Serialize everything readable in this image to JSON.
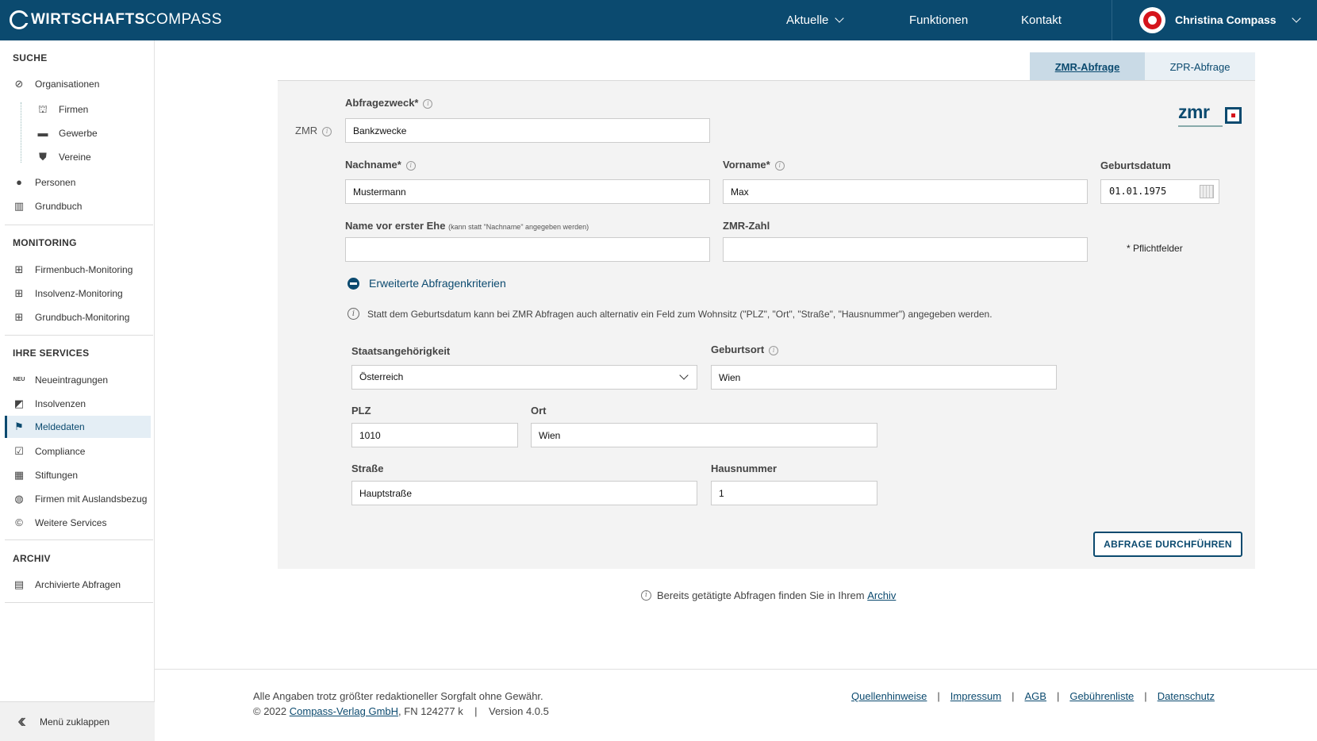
{
  "header": {
    "logo_bold": "WIRTSCHAFTS",
    "logo_light": "COMPASS",
    "nav": [
      "Aktuelle",
      "Funktionen",
      "Kontakt"
    ],
    "user_name": "Christina Compass"
  },
  "sidebar": {
    "suche_title": "SUCHE",
    "suche_items": [
      "Organisationen",
      "Firmen",
      "Gewerbe",
      "Vereine",
      "Personen",
      "Grundbuch"
    ],
    "monitoring_title": "MONITORING",
    "monitoring_items": [
      "Firmenbuch-Monitoring",
      "Insolvenz-Monitoring",
      "Grundbuch-Monitoring"
    ],
    "services_title": "IHRE SERVICES",
    "services_items": [
      "Neueintragungen",
      "Insolvenzen",
      "Meldedaten",
      "Compliance",
      "Stiftungen",
      "Firmen mit Auslandsbezug",
      "Weitere Services"
    ],
    "neu_badge": "NEU",
    "archiv_title": "ARCHIV",
    "archiv_items": [
      "Archivierte Abfragen"
    ],
    "collapse_label": "Menü zuklappen",
    "active_item": "Meldedaten"
  },
  "tabs": [
    "ZMR-Abfrage",
    "ZPR-Abfrage"
  ],
  "form": {
    "zmr_side_label": "ZMR",
    "zmr_logo_text": "zmr",
    "abfragezweck_label": "Abfragezweck*",
    "abfragezweck_value": "Bankzwecke",
    "nachname_label": "Nachname*",
    "nachname_value": "Mustermann",
    "vorname_label": "Vorname*",
    "vorname_value": "Max",
    "geburtsdatum_label": "Geburtsdatum",
    "geburtsdatum_value": "01.01.1975",
    "name_vor_ehe_label": "Name vor erster Ehe",
    "name_vor_ehe_hint": "(kann statt \"Nachname\" angegeben werden)",
    "name_vor_ehe_value": "",
    "zmr_zahl_label": "ZMR-Zahl",
    "zmr_zahl_value": "",
    "pflichtfelder": "* Pflichtfelder",
    "erweitert_label": "Erweiterte Abfragenkriterien",
    "hint_text": "Statt dem Geburtsdatum kann bei ZMR Abfragen auch alternativ ein Feld zum Wohnsitz (\"PLZ\", \"Ort\", \"Straße\", \"Hausnummer\") angegeben werden.",
    "staat_label": "Staatsangehörigkeit",
    "staat_value": "Österreich",
    "geburtsort_label": "Geburtsort",
    "geburtsort_value": "Wien",
    "plz_label": "PLZ",
    "plz_value": "1010",
    "ort_label": "Ort",
    "ort_value": "Wien",
    "strasse_label": "Straße",
    "strasse_value": "Hauptstraße",
    "hausnummer_label": "Hausnummer",
    "hausnummer_value": "1",
    "submit_label": "ABFRAGE DURCHFÜHREN"
  },
  "archive_note": {
    "text": "Bereits getätigte Abfragen finden Sie in Ihrem",
    "link": "Archiv"
  },
  "footer": {
    "disclaimer": "Alle Angaben trotz größter redaktioneller Sorgfalt ohne Gewähr.",
    "copyright_prefix": "© 2022",
    "company_link": "Compass-Verlag GmbH",
    "fn": ", FN 124277 k",
    "sep": "|",
    "version": "Version 4.0.5",
    "links": [
      "Quellenhinweise",
      "Impressum",
      "AGB",
      "Gebührenliste",
      "Datenschutz"
    ]
  },
  "colors": {
    "brand": "#0b4a6f",
    "accent_red": "#d5141c",
    "panel_bg": "#f3f3f3"
  }
}
